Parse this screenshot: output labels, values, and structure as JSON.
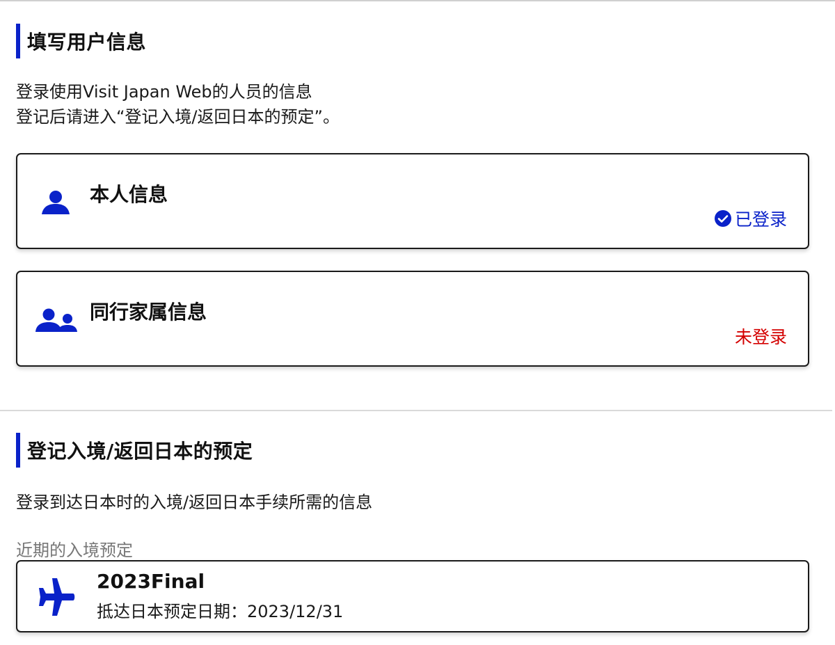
{
  "user_section": {
    "heading": "填写用户信息",
    "desc_line1": "登录使用Visit Japan Web的人员的信息",
    "desc_line2": "登记后请进入“登记入境/返回日本的预定”。",
    "cards": [
      {
        "title": "本人信息",
        "status": "已登录",
        "icon": "person-icon",
        "status_color": "#0a22c9"
      },
      {
        "title": "同行家属信息",
        "status": "未登录",
        "icon": "family-icon",
        "status_color": "#d40000"
      }
    ]
  },
  "entry_section": {
    "heading": "登记入境/返回日本的预定",
    "desc": "登录到达日本时的入境/返回日本手续所需的信息",
    "upcoming_label": "近期的入境预定",
    "trip": {
      "name": "2023Final",
      "date_label": "抵达日本预定日期：",
      "date_value": "2023/12/31",
      "icon": "airplane-icon"
    }
  },
  "colors": {
    "accent": "#0a22c9",
    "error": "#d40000"
  }
}
